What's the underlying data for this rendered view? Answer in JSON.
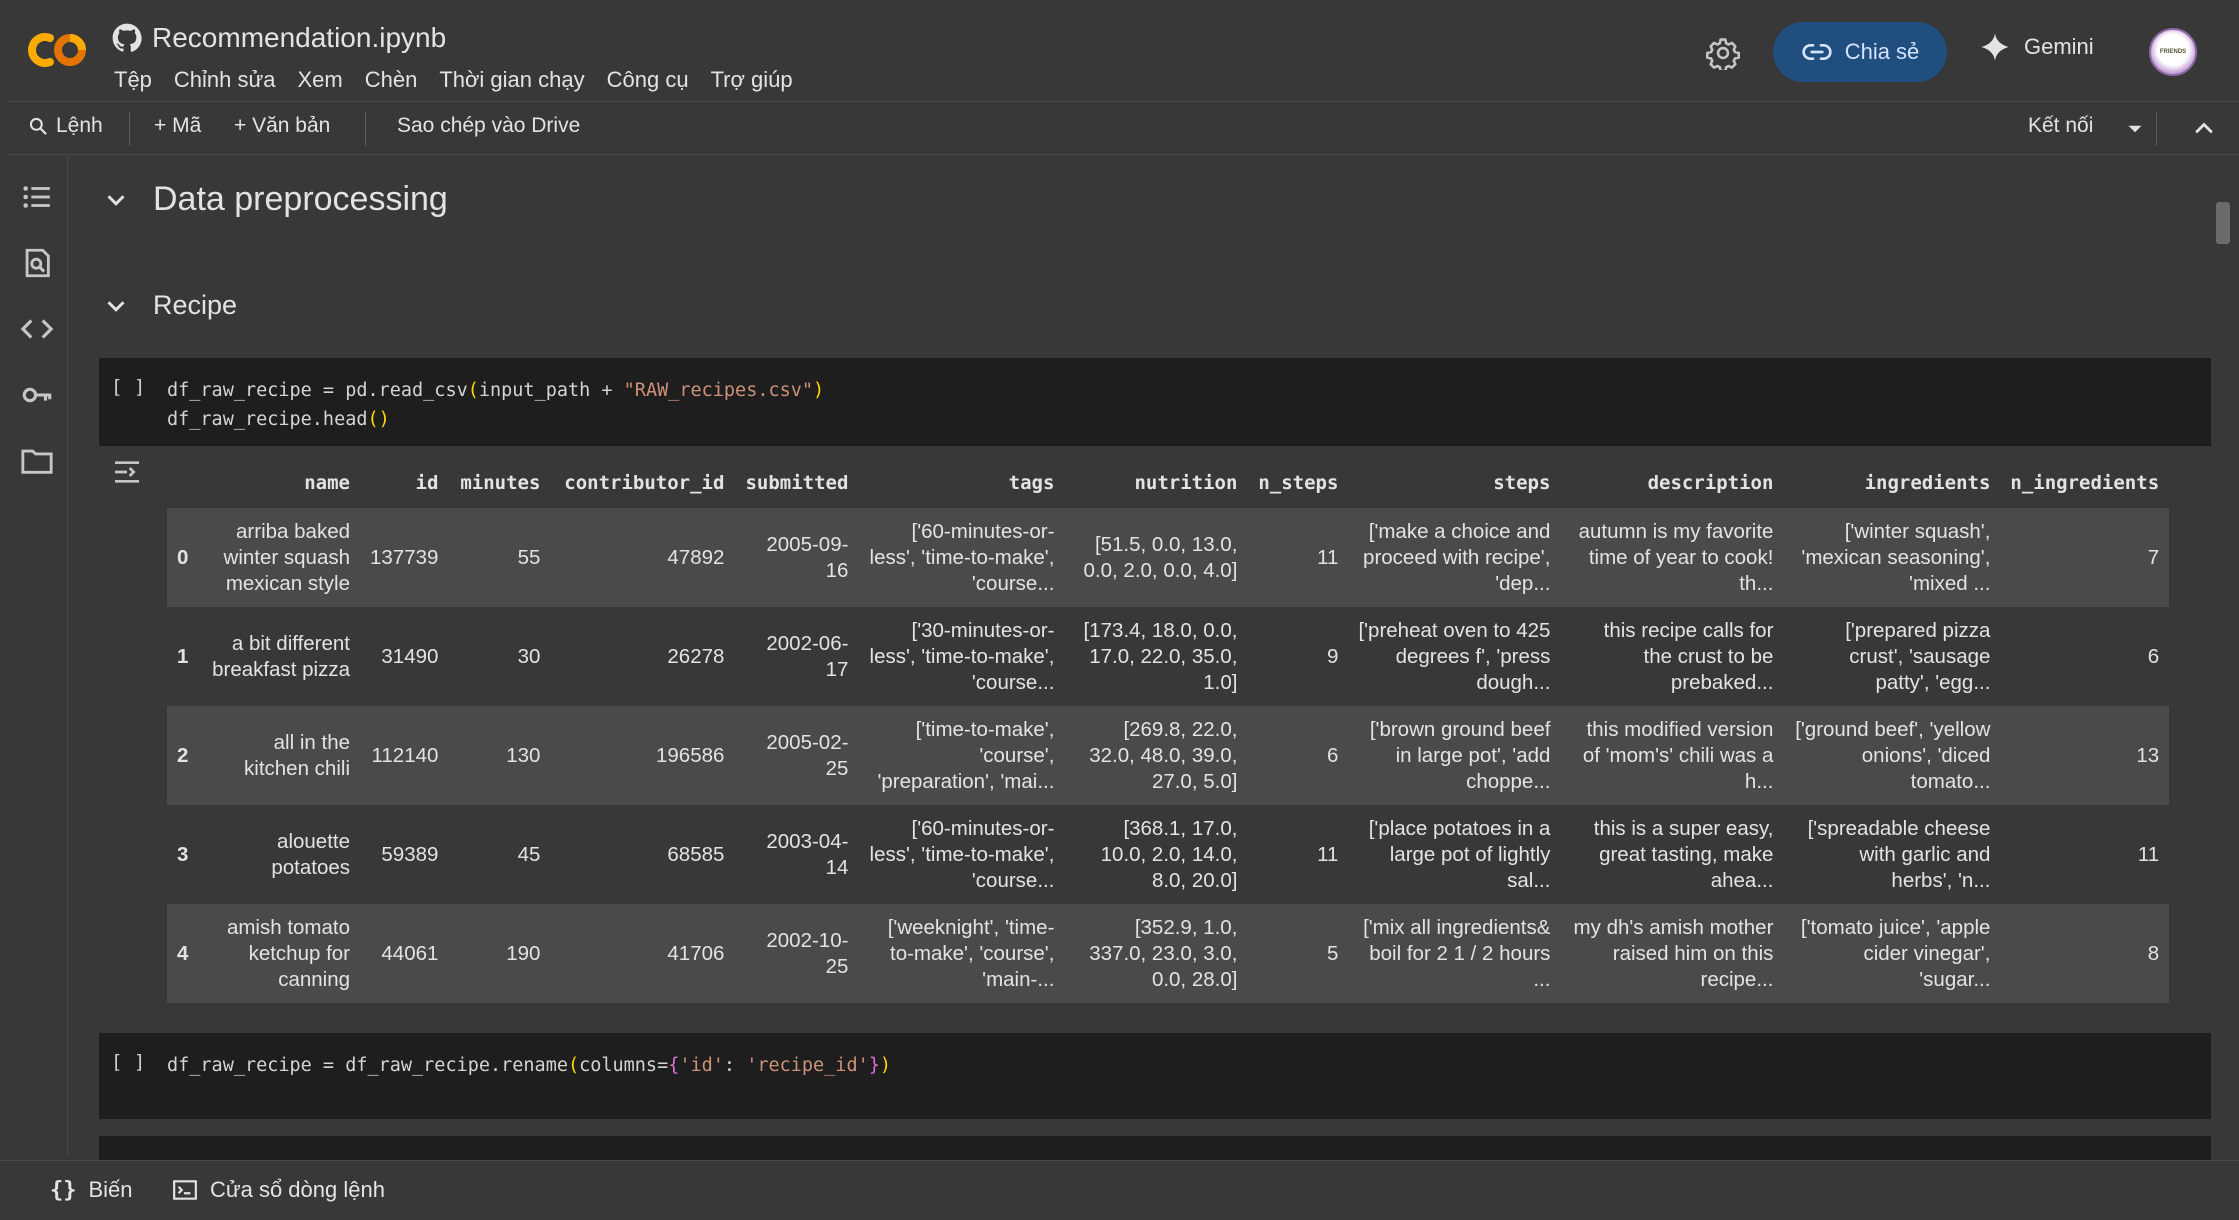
{
  "app": {
    "logo_text": "CO",
    "notebook_title": "Recommendation.ipynb",
    "menu": [
      "Tệp",
      "Chỉnh sửa",
      "Xem",
      "Chèn",
      "Thời gian chạy",
      "Công cụ",
      "Trợ giúp"
    ],
    "share_label": "Chia sẻ",
    "gemini_label": "Gemini",
    "avatar_text": "FRIENDS"
  },
  "toolbar": {
    "command_label": "Lệnh",
    "add_code_label": "+ Mã",
    "add_text_label": "+ Văn bản",
    "copy_to_drive_label": "Sao chép vào Drive",
    "connect_label": "Kết nối"
  },
  "sections": {
    "h1": "Data preprocessing",
    "h2": "Recipe"
  },
  "cells": [
    {
      "bracket": "[ ]",
      "lines": [
        {
          "pre": "df_raw_recipe = pd.read_csv",
          "open": "(",
          "mid": "input_path + ",
          "str": "\"RAW_recipes.csv\"",
          "close": ")"
        },
        {
          "pre": "df_raw_recipe.head",
          "open": "(",
          "mid": "",
          "str": "",
          "close": ")"
        }
      ]
    },
    {
      "bracket": "[ ]",
      "lines": [
        {
          "pre": "df_raw_recipe = df_raw_recipe.rename",
          "open": "(",
          "mid": "columns=",
          "brace_open": "{",
          "str1": "'id'",
          "colon": ": ",
          "str2": "'recipe_id'",
          "brace_close": "}",
          "close": ")"
        }
      ]
    }
  ],
  "dataframe": {
    "columns": [
      "",
      "name",
      "id",
      "minutes",
      "contributor_id",
      "submitted",
      "tags",
      "nutrition",
      "n_steps",
      "steps",
      "description",
      "ingredients",
      "n_ingredients"
    ],
    "rows": [
      [
        "0",
        "arriba baked winter squash mexican style",
        "137739",
        "55",
        "47892",
        "2005-09-16",
        "['60-minutes-or-less', 'time-to-make', 'course...",
        "[51.5, 0.0, 13.0, 0.0, 2.0, 0.0, 4.0]",
        "11",
        "['make a choice and proceed with recipe', 'dep...",
        "autumn is my favorite time of year to cook! th...",
        "['winter squash', 'mexican seasoning', 'mixed ...",
        "7"
      ],
      [
        "1",
        "a bit different breakfast pizza",
        "31490",
        "30",
        "26278",
        "2002-06-17",
        "['30-minutes-or-less', 'time-to-make', 'course...",
        "[173.4, 18.0, 0.0, 17.0, 22.0, 35.0, 1.0]",
        "9",
        "['preheat oven to 425 degrees f', 'press dough...",
        "this recipe calls for the crust to be prebaked...",
        "['prepared pizza crust', 'sausage patty', 'egg...",
        "6"
      ],
      [
        "2",
        "all in the kitchen chili",
        "112140",
        "130",
        "196586",
        "2005-02-25",
        "['time-to-make', 'course', 'preparation', 'mai...",
        "[269.8, 22.0, 32.0, 48.0, 39.0, 27.0, 5.0]",
        "6",
        "['brown ground beef in large pot', 'add choppe...",
        "this modified version of 'mom's' chili was a h...",
        "['ground beef', 'yellow onions', 'diced tomato...",
        "13"
      ],
      [
        "3",
        "alouette potatoes",
        "59389",
        "45",
        "68585",
        "2003-04-14",
        "['60-minutes-or-less', 'time-to-make', 'course...",
        "[368.1, 17.0, 10.0, 2.0, 14.0, 8.0, 20.0]",
        "11",
        "['place potatoes in a large pot of lightly sal...",
        "this is a super easy, great tasting, make ahea...",
        "['spreadable cheese with garlic and herbs', 'n...",
        "11"
      ],
      [
        "4",
        "amish tomato ketchup for canning",
        "44061",
        "190",
        "41706",
        "2002-10-25",
        "['weeknight', 'time-to-make', 'course', 'main-...",
        "[352.9, 1.0, 337.0, 23.0, 3.0, 0.0, 28.0]",
        "5",
        "['mix all ingredients& boil for 2 1 / 2 hours ...",
        "my dh's amish mother raised him on this recipe...",
        "['tomato juice', 'apple cider vinegar', 'sugar...",
        "8"
      ]
    ]
  },
  "statusbar": {
    "variables_label": "Biến",
    "terminal_label": "Cửa sổ dòng lệnh"
  },
  "colors": {
    "background": "#383838",
    "code_bg": "#1e1e1e",
    "share_bg": "#1f4e7f",
    "logo_orange": "#f9ab00",
    "logo_orange_dark": "#e37400",
    "string": "#ce9178"
  },
  "icons": [
    "github-icon",
    "settings-icon",
    "link-icon",
    "gemini-sparkle-icon",
    "search-icon",
    "chevron-down-icon",
    "chevron-up-icon",
    "toc-icon",
    "find-icon",
    "code-icon",
    "key-icon",
    "folder-icon",
    "output-options-icon",
    "variables-icon",
    "terminal-icon"
  ]
}
